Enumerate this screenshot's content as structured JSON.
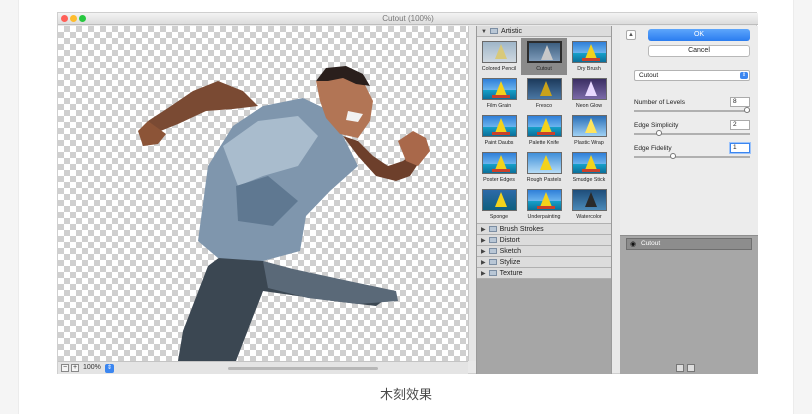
{
  "window": {
    "title": "Cutout (100%)"
  },
  "statusbar": {
    "zoom": "100%"
  },
  "gallery": {
    "open_category": "Artistic",
    "thumbnails": [
      {
        "label": "Colored Pencil"
      },
      {
        "label": "Cutout"
      },
      {
        "label": "Dry Brush"
      },
      {
        "label": "Film Grain"
      },
      {
        "label": "Fresco"
      },
      {
        "label": "Neon Glow"
      },
      {
        "label": "Paint Daubs"
      },
      {
        "label": "Palette Knife"
      },
      {
        "label": "Plastic Wrap"
      },
      {
        "label": "Poster Edges"
      },
      {
        "label": "Rough Pastels"
      },
      {
        "label": "Smudge Stick"
      },
      {
        "label": "Sponge"
      },
      {
        "label": "Underpainting"
      },
      {
        "label": "Watercolor"
      }
    ],
    "selected": "Cutout",
    "categories": [
      "Brush Strokes",
      "Distort",
      "Sketch",
      "Stylize",
      "Texture"
    ]
  },
  "settings": {
    "ok_label": "OK",
    "cancel_label": "Cancel",
    "filter_select": "Cutout",
    "params": [
      {
        "label": "Number of Levels",
        "value": "8",
        "slider_fraction": 1.0
      },
      {
        "label": "Edge Simplicity",
        "value": "2",
        "slider_fraction": 0.2
      },
      {
        "label": "Edge Fidelity",
        "value": "1",
        "slider_fraction": 0.33
      }
    ]
  },
  "layers": {
    "item": "Cutout"
  },
  "caption": "木刻效果"
}
